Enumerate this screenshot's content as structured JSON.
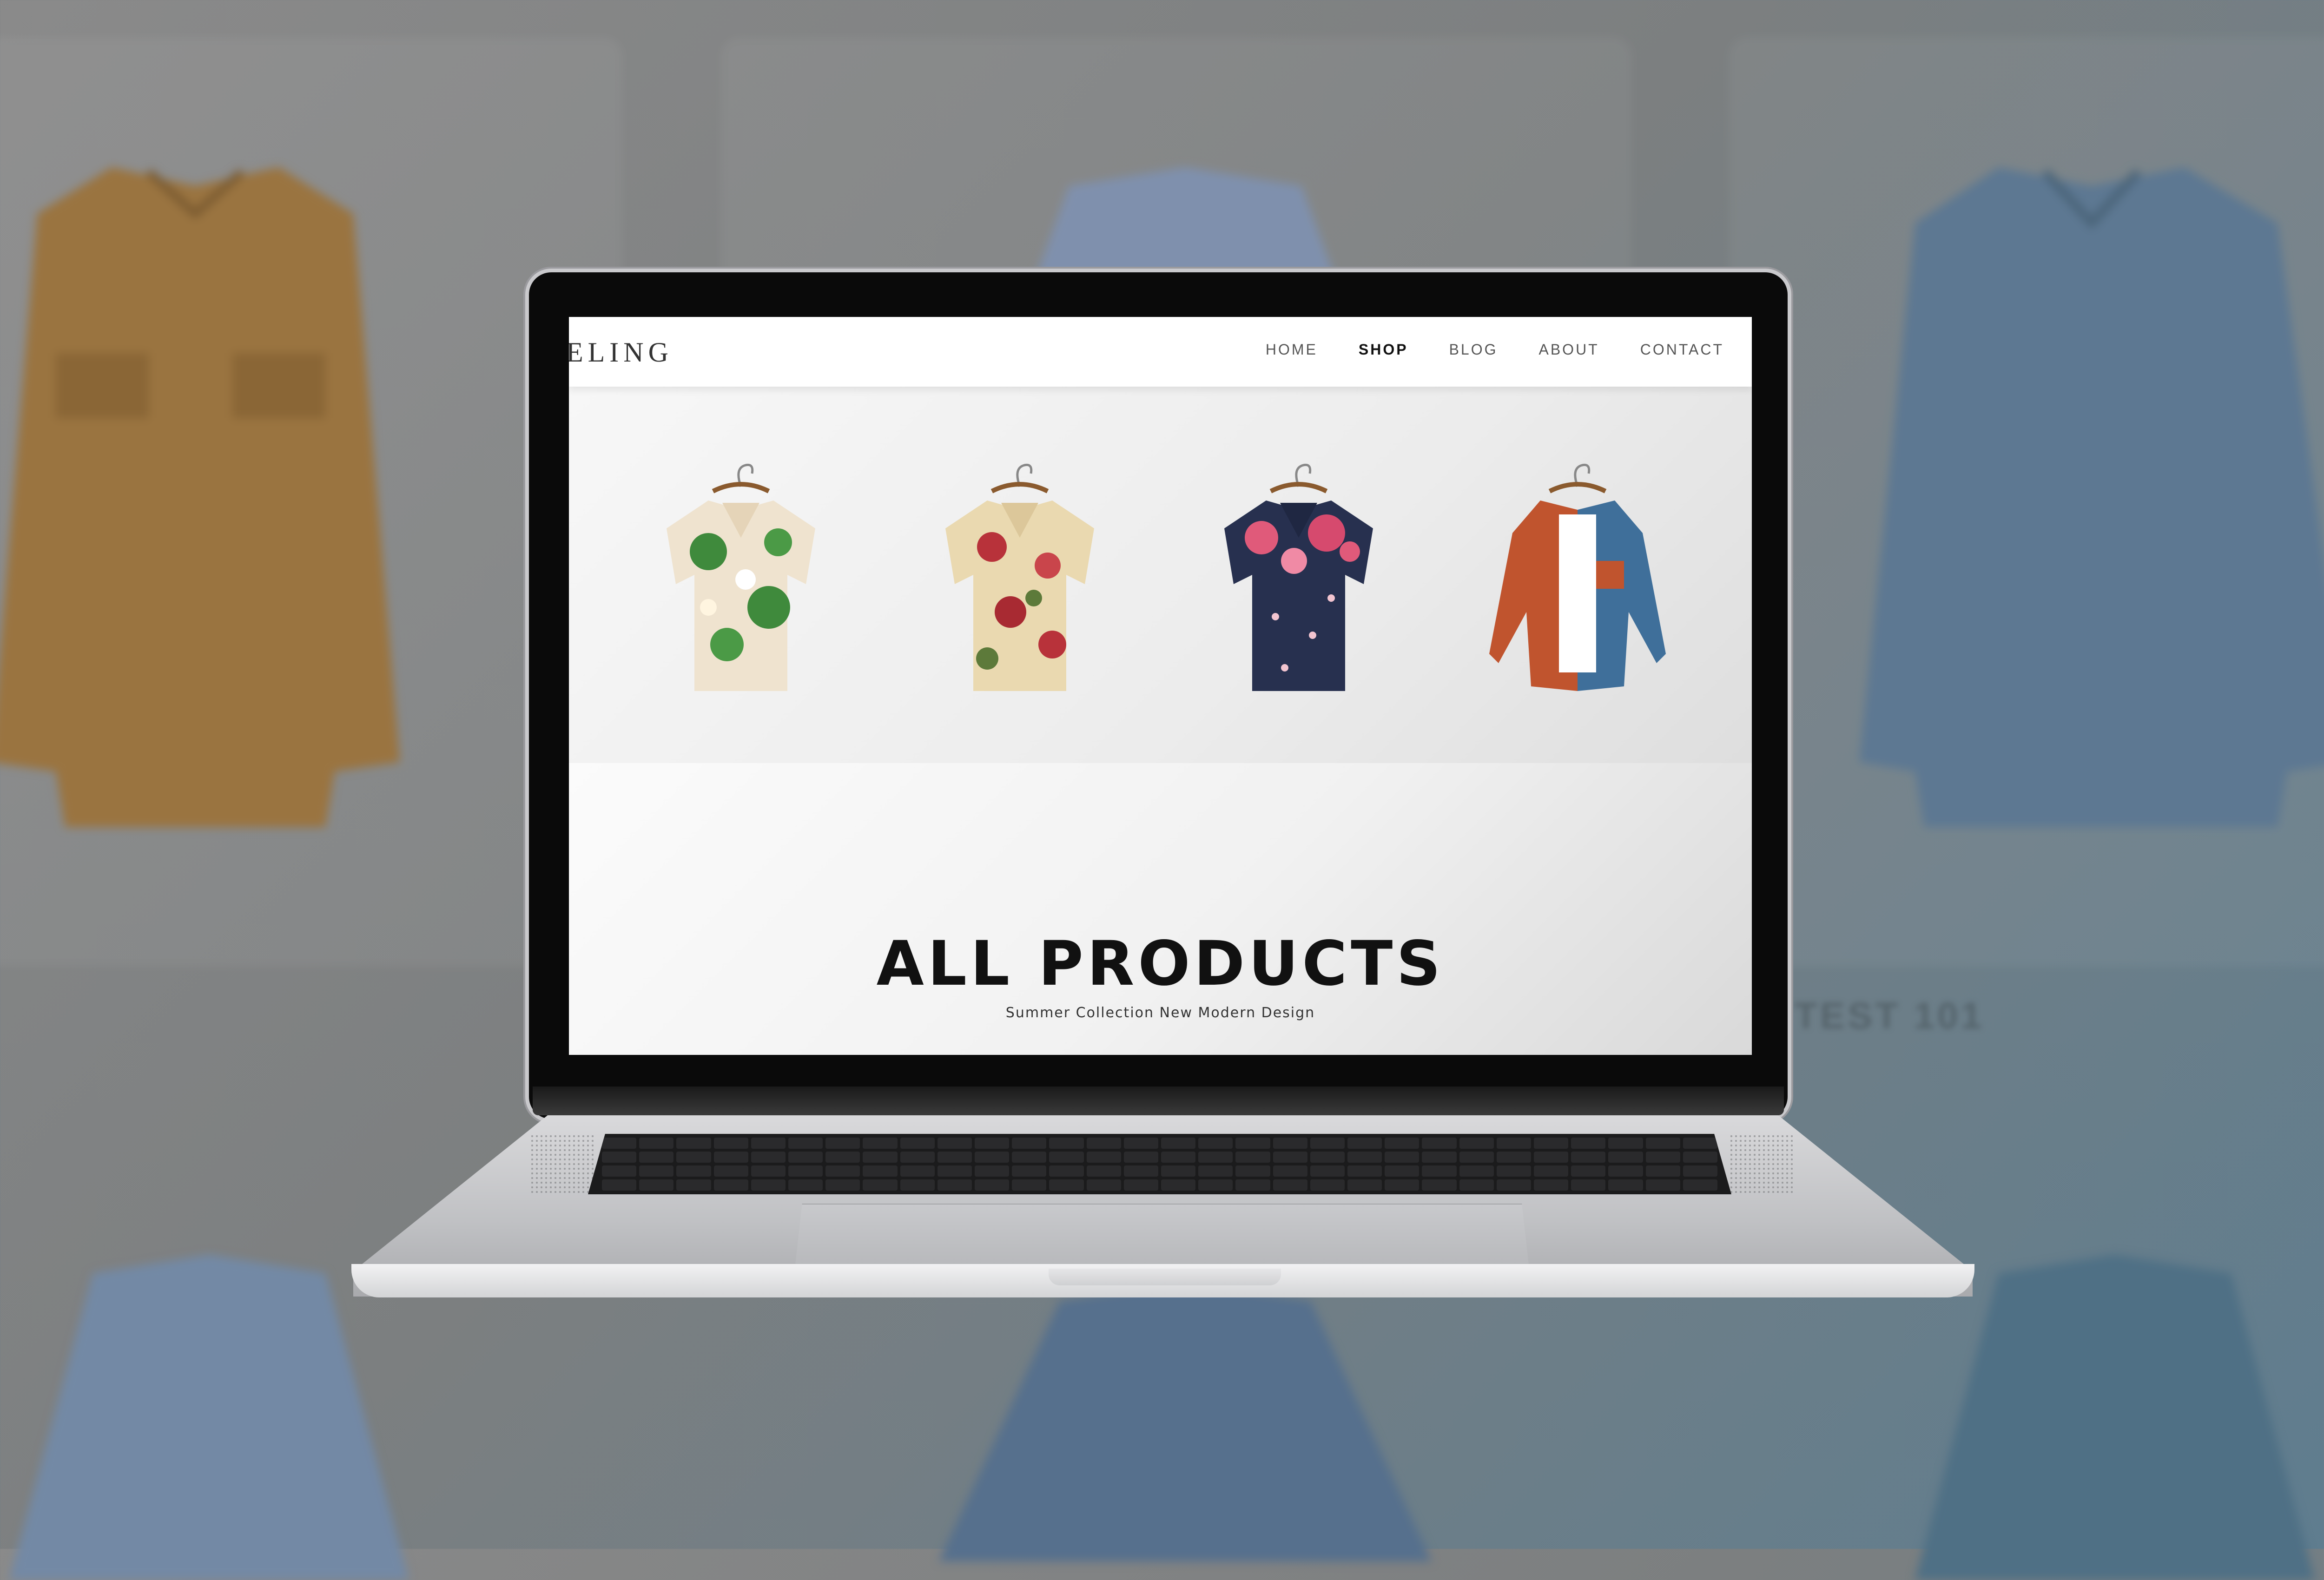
{
  "site": {
    "logo": "ELING",
    "nav": [
      {
        "label": "HOME",
        "active": false
      },
      {
        "label": "SHOP",
        "active": true
      },
      {
        "label": "BLOG",
        "active": false
      },
      {
        "label": "ABOUT",
        "active": false
      },
      {
        "label": "CONTACT",
        "active": false
      }
    ]
  },
  "products": [
    {
      "name": "white-floral-hawaiian-shirt",
      "colors": {
        "base": "#efe3cf",
        "accent": "#3f8a3c"
      }
    },
    {
      "name": "cream-red-floral-shirt",
      "colors": {
        "base": "#ead9b0",
        "accent": "#b8323a"
      }
    },
    {
      "name": "navy-pink-floral-shirt",
      "colors": {
        "base": "#27304f",
        "accent": "#e05a7a"
      }
    },
    {
      "name": "rust-denim-patchwork-shirt",
      "colors": {
        "base": "#c0542e",
        "accent": "#3f6f9a"
      }
    }
  ],
  "section": {
    "title": "ALL PRODUCTS",
    "subtitle": "Summer Collection New Modern Design"
  },
  "background": {
    "text": "M TEST 101"
  }
}
